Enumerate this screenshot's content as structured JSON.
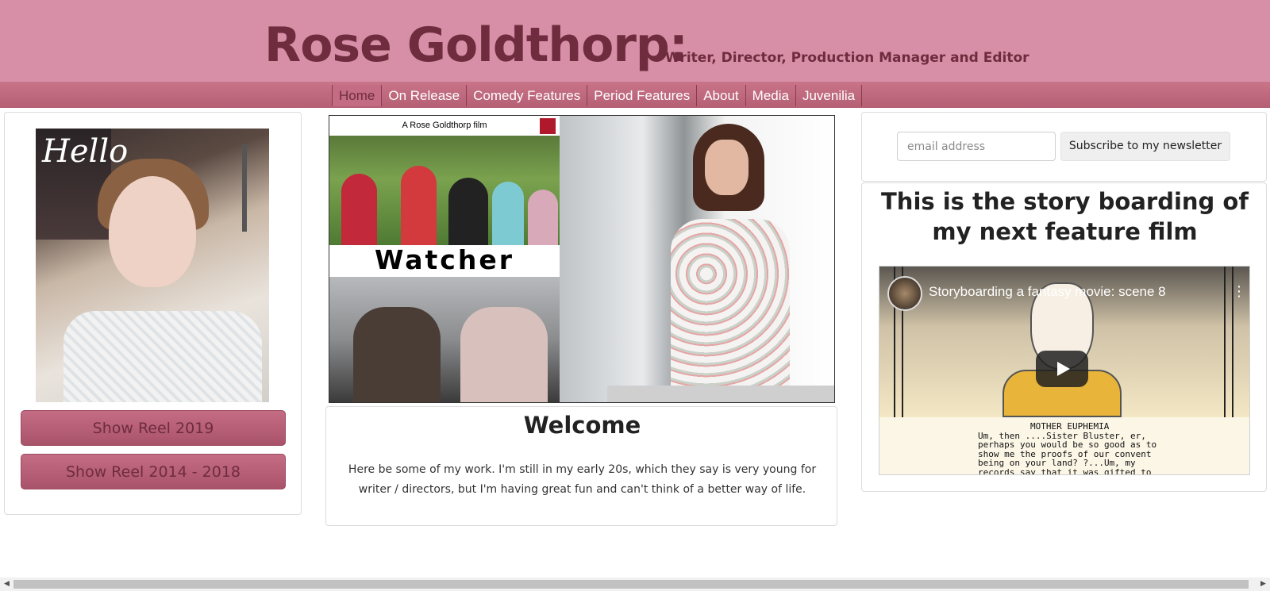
{
  "header": {
    "title": "Rose Goldthorp:",
    "subtitle": "Writer, Director, Production Manager and Editor"
  },
  "nav": {
    "items": [
      {
        "label": "Home",
        "active": true
      },
      {
        "label": "On Release"
      },
      {
        "label": "Comedy Features"
      },
      {
        "label": "Period Features"
      },
      {
        "label": "About"
      },
      {
        "label": "Media"
      },
      {
        "label": "Juvenilia"
      }
    ]
  },
  "left": {
    "portrait_text": "Hello",
    "buttons": [
      "Show Reel 2019",
      "Show Reel 2014 - 2018"
    ]
  },
  "banner": {
    "credit": "A Rose Goldthorp film",
    "title": "Watcher"
  },
  "welcome": {
    "title": "Welcome",
    "text": "Here be some of my work. I'm still in my early 20s, which they say is very young for writer / directors, but I'm having great fun and can't think of a better way of life."
  },
  "newsletter": {
    "placeholder": "email address",
    "button": "Subscribe to my newsletter"
  },
  "story": {
    "title": "This is the story boarding of my next feature film",
    "video": {
      "title": "Storyboarding a fantasy movie: scene 8",
      "script_speaker": "MOTHER EUPHEMIA",
      "script_lines": [
        "Um, then ....Sister Bluster, er,",
        "perhaps you would be so good as to",
        "show me the proofs of our convent",
        "being on your land? ?...Um, my",
        "records say that it was gifted to"
      ]
    }
  },
  "colors": {
    "header_bg": "#d78fa7",
    "nav_bg": "#b55f74",
    "title_color": "#6e2c3e"
  }
}
